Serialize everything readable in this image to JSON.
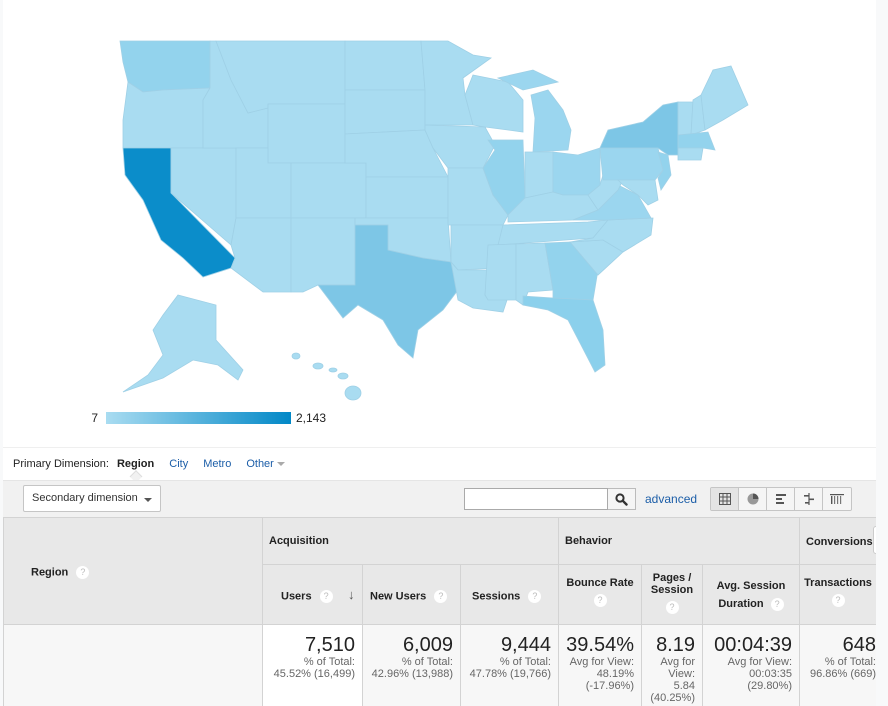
{
  "map": {
    "legend_min": "7",
    "legend_max": "2,143",
    "color_low": "#a9dcf1",
    "color_high": "#0288c7",
    "highlighted_states": {
      "California": "dark",
      "Texas": "medium",
      "New York": "medium",
      "Florida": "medium-light",
      "Illinois": "medium-light",
      "Washington": "light-medium",
      "Georgia": "light-medium",
      "Virginia": "light-medium",
      "Ohio": "light-medium",
      "New Jersey": "light-medium",
      "Massachusetts": "light-medium",
      "Michigan": "light-medium",
      "Pennsylvania": "light-medium"
    }
  },
  "primary_dimension": {
    "label": "Primary Dimension:",
    "active": "Region",
    "options": [
      "City",
      "Metro",
      "Other"
    ]
  },
  "toolbar": {
    "secondary_dimension": "Secondary dimension",
    "search_value": "",
    "advanced": "advanced",
    "view_icons": [
      "table-view-icon",
      "pie-view-icon",
      "performance-view-icon",
      "comparison-view-icon",
      "pivot-view-icon"
    ]
  },
  "table": {
    "region_header": "Region",
    "groups": {
      "acquisition": "Acquisition",
      "behavior": "Behavior",
      "conversions": "Conversions"
    },
    "columns": {
      "users": "Users",
      "new_users": "New Users",
      "sessions": "Sessions",
      "bounce_rate": "Bounce Rate",
      "pages_session": "Pages / Session",
      "avg_session_1": "Avg. Session",
      "avg_session_2": "Duration",
      "transactions": "Transactions"
    },
    "totals": {
      "users": {
        "value": "7,510",
        "l1": "% of Total:",
        "l2": "45.52% (16,499)"
      },
      "new_users": {
        "value": "6,009",
        "l1": "% of Total:",
        "l2": "42.96% (13,988)"
      },
      "sessions": {
        "value": "9,444",
        "l1": "% of Total:",
        "l2": "47.78% (19,766)"
      },
      "bounce_rate": {
        "value": "39.54%",
        "l1": "Avg for View:",
        "l2": "48.19%",
        "l3": "(-17.96%)"
      },
      "pages_session": {
        "value": "8.19",
        "l1": "Avg for",
        "l2": "View:",
        "l3": "5.84",
        "l4": "(40.25%)"
      },
      "avg_session": {
        "value": "00:04:39",
        "l1": "Avg for View:",
        "l2": "00:03:35",
        "l3": "(29.80%)"
      },
      "transactions": {
        "value": "648",
        "l1": "% of Total:",
        "l2": "96.86% (669)"
      }
    },
    "help": "?"
  }
}
